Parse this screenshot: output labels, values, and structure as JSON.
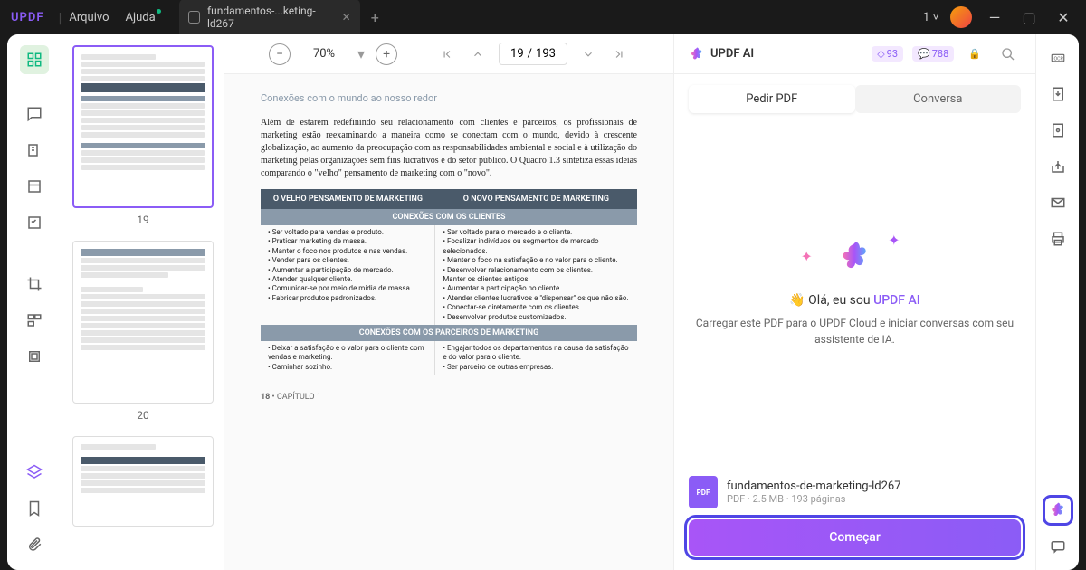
{
  "titlebar": {
    "logo": "UPDF",
    "menu_file": "Arquivo",
    "menu_help": "Ajuda",
    "tab_title": "fundamentos-...keting-ld267",
    "account": "1"
  },
  "viewer": {
    "zoom": "70%",
    "page_current": "19",
    "page_sep": "/",
    "page_total": "193"
  },
  "page": {
    "heading": "Conexões com o mundo ao nosso redor",
    "paragraph": "Além de estarem redefinindo seu relacionamento com clientes e parceiros, os profissionais de marketing estão reexaminando a maneira como se conectam com o mundo, devido à crescente globalização, ao aumento da preocupação com as responsabilidades ambiental e social e à utilização do marketing pelas organizações sem fins lucrativos e do setor público. O Quadro 1.3 sintetiza essas ideias comparando o \"velho\" pensamento de marketing com o \"novo\".",
    "th_old": "O VELHO PENSAMENTO DE MARKETING",
    "th_new": "O NOVO PENSAMENTO DE MARKETING",
    "sub1": "CONEXÕES COM OS CLIENTES",
    "old1": "• Ser voltado para vendas e produto.\n• Praticar marketing de massa.\n• Manter o foco nos produtos e nas vendas.\n• Vender para os clientes.\n• Aumentar a participação de mercado.\n• Atender qualquer cliente.\n• Comunicar-se por meio de mídia de massa.\n• Fabricar produtos padronizados.",
    "new1": "• Ser voltado para o mercado e o cliente.\n• Focalizar indivíduos ou segmentos de mercado selecionados.\n• Manter o foco na satisfação e no valor para o cliente.\n• Desenvolver relacionamento com os clientes.\nManter os clientes antigos\n• Aumentar a participação no cliente.\n• Atender clientes lucrativos e \"dispensar\" os que não são.\n• Conectar-se diretamente com os clientes.\n• Desenvolver produtos customizados.",
    "sub2": "CONEXÕES COM OS PARCEIROS DE MARKETING",
    "old2": "• Deixar a satisfação e o valor para o cliente com vendas e marketing.\n• Caminhar sozinho.",
    "new2": "• Engajar todos os departamentos na causa da satisfação e do valor para o cliente.\n• Ser parceiro de outras empresas.",
    "footer_page": "18",
    "footer_chapter": "CAPÍTULO 1"
  },
  "thumbs": {
    "t1": "19",
    "t2": "20"
  },
  "ai": {
    "title": "UPDF AI",
    "badge1": "93",
    "badge2": "788",
    "tab_ask": "Pedir PDF",
    "tab_chat": "Conversa",
    "greeting_pre": "👋 Olá, eu sou ",
    "greeting_brand": "UPDF AI",
    "desc": "Carregar este PDF para o UPDF Cloud e iniciar conversas com seu assistente de IA.",
    "file_name": "fundamentos-de-marketing-ld267",
    "file_meta": "PDF · 2.5 MB · 193 páginas",
    "file_icon_label": "PDF",
    "start": "Começar"
  }
}
